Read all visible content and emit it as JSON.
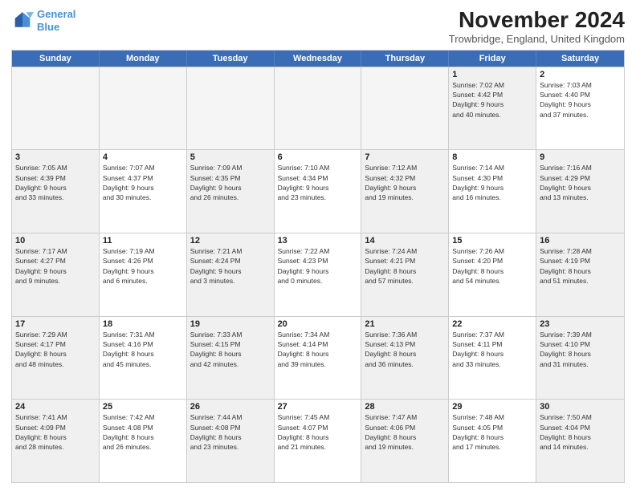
{
  "logo": {
    "line1": "General",
    "line2": "Blue"
  },
  "title": "November 2024",
  "location": "Trowbridge, England, United Kingdom",
  "weekdays": [
    "Sunday",
    "Monday",
    "Tuesday",
    "Wednesday",
    "Thursday",
    "Friday",
    "Saturday"
  ],
  "rows": [
    [
      {
        "day": "",
        "info": "",
        "empty": true
      },
      {
        "day": "",
        "info": "",
        "empty": true
      },
      {
        "day": "",
        "info": "",
        "empty": true
      },
      {
        "day": "",
        "info": "",
        "empty": true
      },
      {
        "day": "",
        "info": "",
        "empty": true
      },
      {
        "day": "1",
        "info": "Sunrise: 7:02 AM\nSunset: 4:42 PM\nDaylight: 9 hours\nand 40 minutes.",
        "shaded": true
      },
      {
        "day": "2",
        "info": "Sunrise: 7:03 AM\nSunset: 4:40 PM\nDaylight: 9 hours\nand 37 minutes.",
        "shaded": false
      }
    ],
    [
      {
        "day": "3",
        "info": "Sunrise: 7:05 AM\nSunset: 4:39 PM\nDaylight: 9 hours\nand 33 minutes.",
        "shaded": true
      },
      {
        "day": "4",
        "info": "Sunrise: 7:07 AM\nSunset: 4:37 PM\nDaylight: 9 hours\nand 30 minutes.",
        "shaded": false
      },
      {
        "day": "5",
        "info": "Sunrise: 7:09 AM\nSunset: 4:35 PM\nDaylight: 9 hours\nand 26 minutes.",
        "shaded": true
      },
      {
        "day": "6",
        "info": "Sunrise: 7:10 AM\nSunset: 4:34 PM\nDaylight: 9 hours\nand 23 minutes.",
        "shaded": false
      },
      {
        "day": "7",
        "info": "Sunrise: 7:12 AM\nSunset: 4:32 PM\nDaylight: 9 hours\nand 19 minutes.",
        "shaded": true
      },
      {
        "day": "8",
        "info": "Sunrise: 7:14 AM\nSunset: 4:30 PM\nDaylight: 9 hours\nand 16 minutes.",
        "shaded": false
      },
      {
        "day": "9",
        "info": "Sunrise: 7:16 AM\nSunset: 4:29 PM\nDaylight: 9 hours\nand 13 minutes.",
        "shaded": true
      }
    ],
    [
      {
        "day": "10",
        "info": "Sunrise: 7:17 AM\nSunset: 4:27 PM\nDaylight: 9 hours\nand 9 minutes.",
        "shaded": true
      },
      {
        "day": "11",
        "info": "Sunrise: 7:19 AM\nSunset: 4:26 PM\nDaylight: 9 hours\nand 6 minutes.",
        "shaded": false
      },
      {
        "day": "12",
        "info": "Sunrise: 7:21 AM\nSunset: 4:24 PM\nDaylight: 9 hours\nand 3 minutes.",
        "shaded": true
      },
      {
        "day": "13",
        "info": "Sunrise: 7:22 AM\nSunset: 4:23 PM\nDaylight: 9 hours\nand 0 minutes.",
        "shaded": false
      },
      {
        "day": "14",
        "info": "Sunrise: 7:24 AM\nSunset: 4:21 PM\nDaylight: 8 hours\nand 57 minutes.",
        "shaded": true
      },
      {
        "day": "15",
        "info": "Sunrise: 7:26 AM\nSunset: 4:20 PM\nDaylight: 8 hours\nand 54 minutes.",
        "shaded": false
      },
      {
        "day": "16",
        "info": "Sunrise: 7:28 AM\nSunset: 4:19 PM\nDaylight: 8 hours\nand 51 minutes.",
        "shaded": true
      }
    ],
    [
      {
        "day": "17",
        "info": "Sunrise: 7:29 AM\nSunset: 4:17 PM\nDaylight: 8 hours\nand 48 minutes.",
        "shaded": true
      },
      {
        "day": "18",
        "info": "Sunrise: 7:31 AM\nSunset: 4:16 PM\nDaylight: 8 hours\nand 45 minutes.",
        "shaded": false
      },
      {
        "day": "19",
        "info": "Sunrise: 7:33 AM\nSunset: 4:15 PM\nDaylight: 8 hours\nand 42 minutes.",
        "shaded": true
      },
      {
        "day": "20",
        "info": "Sunrise: 7:34 AM\nSunset: 4:14 PM\nDaylight: 8 hours\nand 39 minutes.",
        "shaded": false
      },
      {
        "day": "21",
        "info": "Sunrise: 7:36 AM\nSunset: 4:13 PM\nDaylight: 8 hours\nand 36 minutes.",
        "shaded": true
      },
      {
        "day": "22",
        "info": "Sunrise: 7:37 AM\nSunset: 4:11 PM\nDaylight: 8 hours\nand 33 minutes.",
        "shaded": false
      },
      {
        "day": "23",
        "info": "Sunrise: 7:39 AM\nSunset: 4:10 PM\nDaylight: 8 hours\nand 31 minutes.",
        "shaded": true
      }
    ],
    [
      {
        "day": "24",
        "info": "Sunrise: 7:41 AM\nSunset: 4:09 PM\nDaylight: 8 hours\nand 28 minutes.",
        "shaded": true
      },
      {
        "day": "25",
        "info": "Sunrise: 7:42 AM\nSunset: 4:08 PM\nDaylight: 8 hours\nand 26 minutes.",
        "shaded": false
      },
      {
        "day": "26",
        "info": "Sunrise: 7:44 AM\nSunset: 4:08 PM\nDaylight: 8 hours\nand 23 minutes.",
        "shaded": true
      },
      {
        "day": "27",
        "info": "Sunrise: 7:45 AM\nSunset: 4:07 PM\nDaylight: 8 hours\nand 21 minutes.",
        "shaded": false
      },
      {
        "day": "28",
        "info": "Sunrise: 7:47 AM\nSunset: 4:06 PM\nDaylight: 8 hours\nand 19 minutes.",
        "shaded": true
      },
      {
        "day": "29",
        "info": "Sunrise: 7:48 AM\nSunset: 4:05 PM\nDaylight: 8 hours\nand 17 minutes.",
        "shaded": false
      },
      {
        "day": "30",
        "info": "Sunrise: 7:50 AM\nSunset: 4:04 PM\nDaylight: 8 hours\nand 14 minutes.",
        "shaded": true
      }
    ]
  ]
}
